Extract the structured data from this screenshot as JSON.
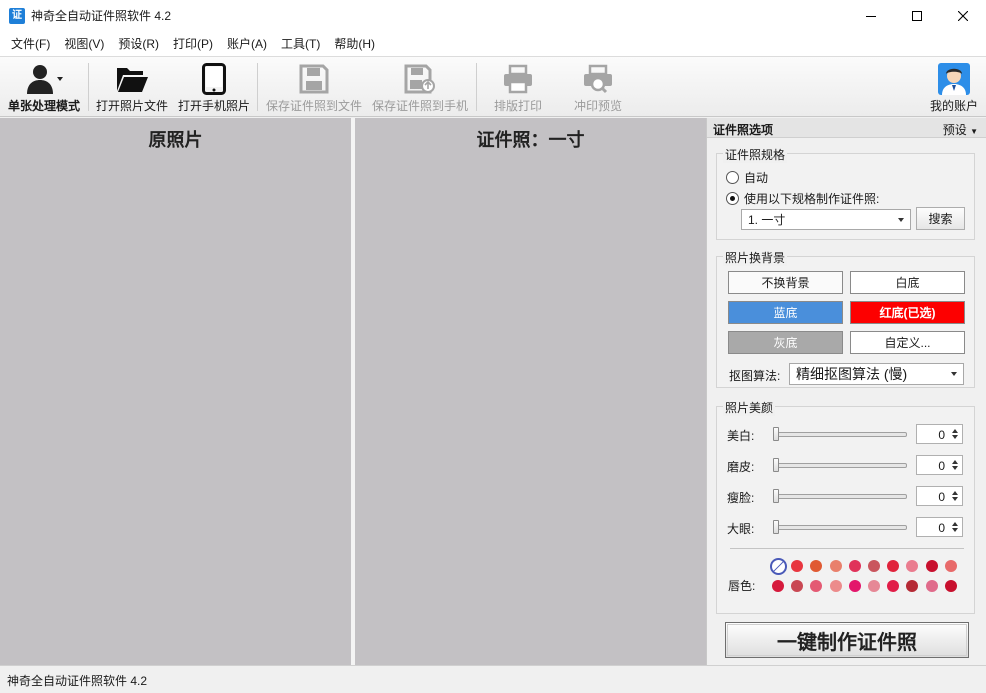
{
  "window": {
    "title": "神奇全自动证件照软件 4.2",
    "app_icon_text": "证"
  },
  "menu": [
    "文件(F)",
    "视图(V)",
    "预设(R)",
    "打印(P)",
    "账户(A)",
    "工具(T)",
    "帮助(H)"
  ],
  "toolbar": {
    "mode_label": "单张处理模式",
    "open_photo_label": "打开照片文件",
    "open_phone_label": "打开手机照片",
    "save_file_label": "保存证件照到文件",
    "save_phone_label": "保存证件照到手机",
    "layout_print_label": "排版打印",
    "print_preview_label": "冲印预览",
    "account_label": "我的账户"
  },
  "panes": {
    "original_title": "原照片",
    "id_photo_title": "证件照：一寸"
  },
  "options": {
    "header_title": "证件照选项",
    "preset_label": "预设",
    "spec": {
      "group_title": "证件照规格",
      "auto_label": "自动",
      "use_spec_label": "使用以下规格制作证件照:",
      "selected_spec": "1. 一寸",
      "search_label": "搜索"
    },
    "background": {
      "group_title": "照片换背景",
      "no_change": "不换背景",
      "white": "白底",
      "blue": "蓝底",
      "red": "红底(已选)",
      "gray": "灰底",
      "custom": "自定义...",
      "algo_label": "抠图算法:",
      "algo_value": "精细抠图算法 (慢)",
      "colors": {
        "blue": "#4a8fdb",
        "red": "#fd0000",
        "gray": "#a9a9a9"
      }
    },
    "beauty": {
      "group_title": "照片美颜",
      "sliders": [
        {
          "label": "美白:",
          "value": "0"
        },
        {
          "label": "磨皮:",
          "value": "0"
        },
        {
          "label": "瘦脸:",
          "value": "0"
        },
        {
          "label": "大眼:",
          "value": "0"
        }
      ],
      "lip_label": "唇色:",
      "lip_colors": [
        "none",
        "#e8363f",
        "#e05a33",
        "#e9806c",
        "#e0325a",
        "#c9565e",
        "#e0233c",
        "#ea7c8f",
        "#c8102e",
        "#e86a6a",
        "#d61a3c",
        "#c94853",
        "#e45a73",
        "#ec8b8b",
        "#e3166b",
        "#e68896",
        "#e11d48",
        "#b52a35",
        "#e06b8b",
        "#c8102e"
      ]
    },
    "make_button": "一键制作证件照"
  },
  "status": {
    "text": "神奇全自动证件照软件 4.2"
  }
}
